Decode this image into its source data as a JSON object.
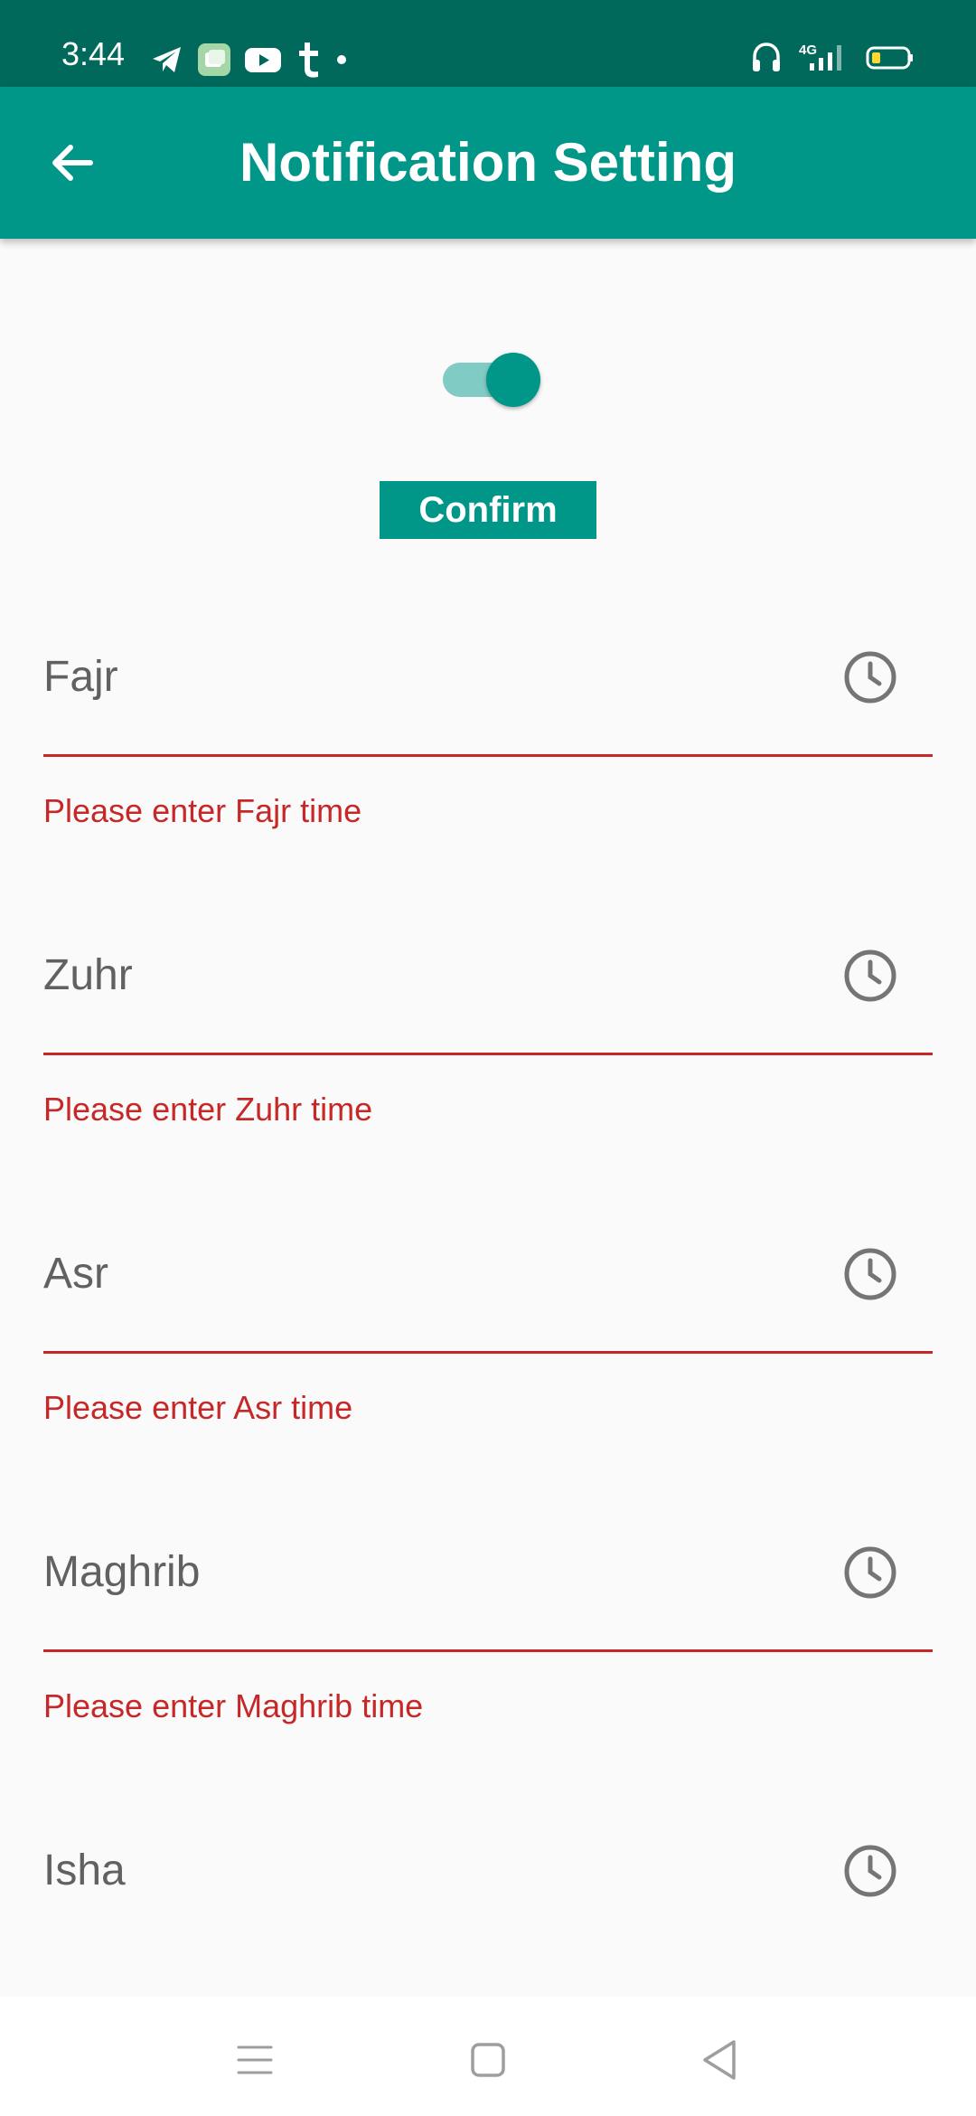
{
  "status_bar": {
    "time": "3:44",
    "left_icons": [
      "telegram-icon",
      "app-icon",
      "youtube-icon",
      "tumblr-icon",
      "notification-dot-icon"
    ],
    "right_icons": [
      "headset-icon",
      "signal-4g-icon",
      "battery-icon"
    ],
    "network_label": "4G"
  },
  "app_bar": {
    "title": "Notification Setting",
    "color": "#009688",
    "status_color": "#00695c"
  },
  "notification_toggle": {
    "on": true
  },
  "confirm_label": "Confirm",
  "prayers": [
    {
      "placeholder": "Fajr",
      "value": "",
      "error": "Please enter Fajr time"
    },
    {
      "placeholder": "Zuhr",
      "value": "",
      "error": "Please enter Zuhr time"
    },
    {
      "placeholder": "Asr",
      "value": "",
      "error": "Please enter Asr time"
    },
    {
      "placeholder": "Maghrib",
      "value": "",
      "error": "Please enter Maghrib time"
    },
    {
      "placeholder": "Isha",
      "value": "",
      "error": ""
    }
  ],
  "error_color": "#c62828",
  "nav_bar": {
    "buttons": [
      "menu-icon",
      "home-square-icon",
      "back-triangle-icon"
    ]
  }
}
